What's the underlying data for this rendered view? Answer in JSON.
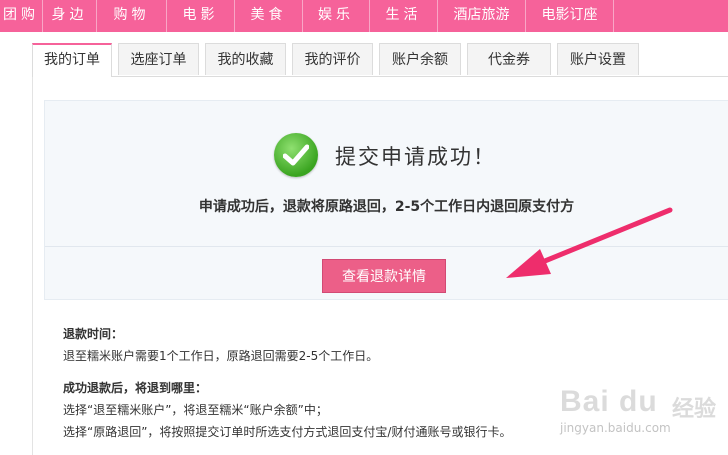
{
  "topnav": {
    "items": [
      "团购",
      "身边",
      "购物",
      "电影",
      "美食",
      "娱乐",
      "生活",
      "酒店旅游",
      "电影订座"
    ]
  },
  "tabs": [
    {
      "label": "我的订单",
      "active": true
    },
    {
      "label": "选座订单",
      "active": false
    },
    {
      "label": "我的收藏",
      "active": false
    },
    {
      "label": "我的评价",
      "active": false
    },
    {
      "label": "账户余额",
      "active": false
    },
    {
      "label": "代金券",
      "active": false
    },
    {
      "label": "账户设置",
      "active": false
    }
  ],
  "success": {
    "title": "提交申请成功！",
    "description": "申请成功后，退款将原路退回，2-5个工作日内退回原支付方",
    "button_label": "查看退款详情"
  },
  "info": {
    "time_heading": "退款时间：",
    "time_text": "退至糯米账户需要1个工作日，原路退回需要2-5个工作日。",
    "where_heading": "成功退款后，将退到哪里：",
    "where_line1": "选择“退至糯米账户”，将退至糯米“账户余额”中；",
    "where_line2": "选择“原路退回”，将按照提交订单时所选支付方式退回支付宝/财付通账号或银行卡。"
  },
  "watermark": {
    "brand": "Bai du",
    "brand_cn": "经验",
    "url": "jingyan.baidu.com"
  },
  "colors": {
    "nav_bg": "#f6629a",
    "button_bg": "#ec5f88",
    "arrow": "#ee2d6c",
    "success_green": "#3aa420"
  }
}
